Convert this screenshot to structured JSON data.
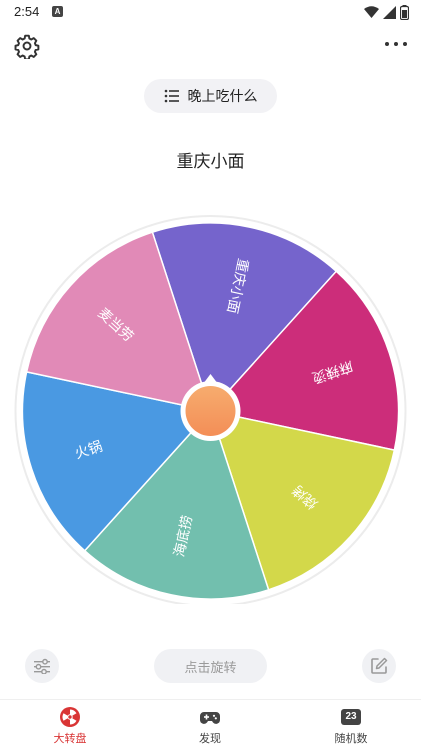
{
  "status_bar": {
    "time": "2:54",
    "notification_glyph": "A",
    "icons": [
      "wifi-icon",
      "signal-icon",
      "battery-icon"
    ]
  },
  "header": {
    "settings_icon": "gear-icon",
    "more_icon": "more-horizontal-icon"
  },
  "wheel_selector": {
    "label": "晚上吃什么",
    "icon": "list-icon"
  },
  "result": {
    "text": "重庆小面"
  },
  "wheel": {
    "segments": [
      {
        "label": "重庆小面",
        "color": "#7564cc"
      },
      {
        "label": "麻辣烫",
        "color": "#cc2d7a"
      },
      {
        "label": "烧烤",
        "color": "#d3d84a"
      },
      {
        "label": "海底捞",
        "color": "#72bfae"
      },
      {
        "label": "火锅",
        "color": "#4a99e2"
      },
      {
        "label": "麦当劳",
        "color": "#e18ab7"
      }
    ],
    "hub_color": "#f49a5e"
  },
  "controls": {
    "spin_label": "点击旋转",
    "left_icon": "sliders-icon",
    "right_icon": "edit-icon"
  },
  "nav": {
    "items": [
      {
        "label": "大转盘",
        "icon": "wheel-icon",
        "active": true
      },
      {
        "label": "发现",
        "icon": "gamepad-icon",
        "active": false
      },
      {
        "label": "随机数",
        "icon": "number-icon",
        "badge": "23",
        "active": false
      }
    ]
  },
  "colors": {
    "accent": "#d93535"
  }
}
